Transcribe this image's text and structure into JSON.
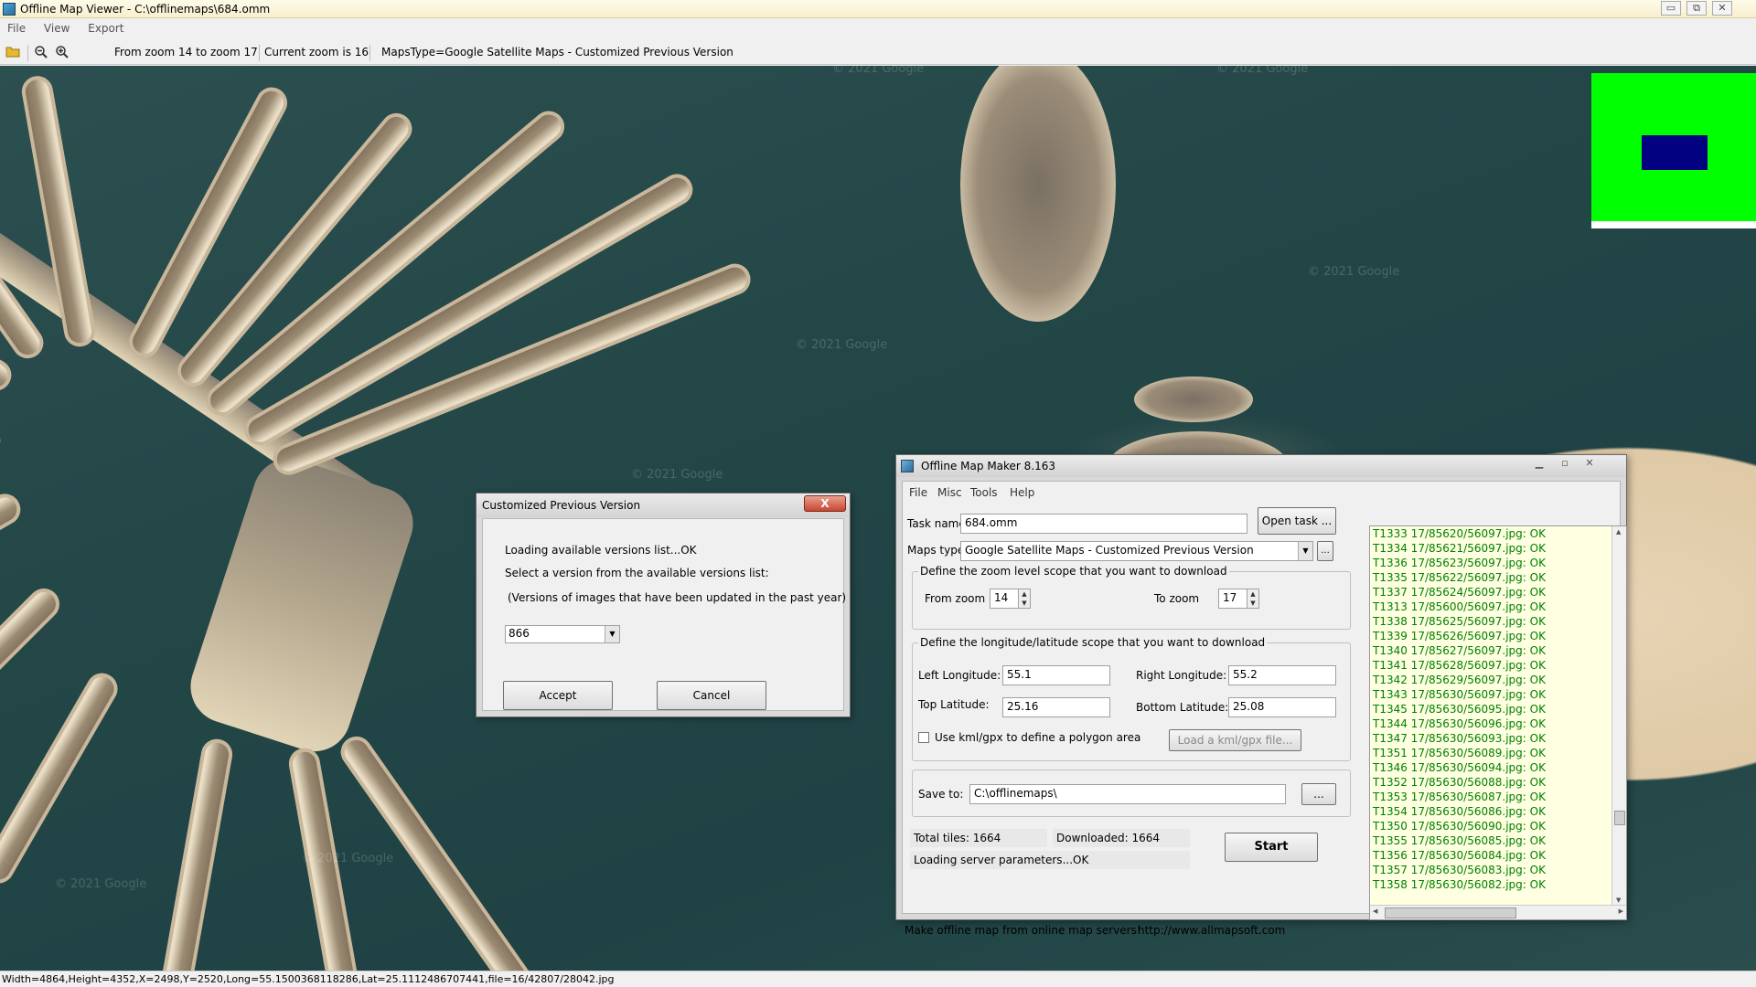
{
  "window": {
    "title": "Offline Map Viewer - C:\\offlinemaps\\684.omm",
    "controls": [
      "▭",
      "⧉",
      "✕"
    ]
  },
  "menubar": [
    "File",
    "View",
    "Export"
  ],
  "toolbar": {
    "zoom_range": "From zoom 14 to zoom 17",
    "current_zoom": "Current zoom is 16",
    "maps_type": "MapsType=Google Satellite Maps - Customized Previous Version"
  },
  "map": {
    "watermarks": [
      "© 2021 Google",
      "© 2021 Google",
      "© 2021 Google",
      "© 2021 Google",
      "© 2021 Google",
      "© 2021 Google",
      "© 2021 Google"
    ],
    "overview": {
      "colors": {
        "background": "#00ff00",
        "viewport": "#000080"
      }
    }
  },
  "statusbar": "Width=4864,Height=4352,X=2498,Y=2520,Long=55.1500368118286,Lat=25.1112486707441,file=16/42807/28042.jpg",
  "cpv_dialog": {
    "title": "Customized Previous Version",
    "close_label": "X",
    "line1": "Loading available versions list...OK",
    "line2": "Select a version  from the available versions list:",
    "line3": "(Versions of images that have been updated in the past year)",
    "version_value": "866",
    "accept_label": "Accept",
    "cancel_label": "Cancel"
  },
  "omm": {
    "title": "Offline Map Maker 8.163",
    "menu": [
      "File",
      "Misc",
      "Tools",
      "Help"
    ],
    "task_label": "Task name:",
    "task_value": "684.omm",
    "open_task_label": "Open task ...",
    "maps_type_label": "Maps type:",
    "maps_type_value": "Google Satellite Maps - Customized Previous Version",
    "browse_small": "...",
    "zoom_group": "Define the zoom level scope that you want to download",
    "from_zoom_label": "From zoom",
    "from_zoom_value": "14",
    "to_zoom_label": "To zoom",
    "to_zoom_value": "17",
    "lonlat_group": "Define the longitude/latitude scope that you want to download",
    "left_lon_label": "Left Longitude:",
    "left_lon_value": "55.1",
    "right_lon_label": "Right Longitude:",
    "right_lon_value": "55.2",
    "top_lat_label": "Top Latitude:",
    "top_lat_value": "25.16",
    "bottom_lat_label": "Bottom Latitude:",
    "bottom_lat_value": "25.08",
    "kml_label": "Use kml/gpx to define a polygon area",
    "load_kml_label": "Load a kml/gpx file...",
    "save_to_label": "Save to:",
    "save_to_value": "C:\\offlinemaps\\",
    "save_browse": "...",
    "total_tiles": "Total tiles: 1664",
    "downloaded": "Downloaded: 1664",
    "server_status": "Loading server parameters...OK",
    "start_label": "Start",
    "footer_text": "Make offline map from online map servers!",
    "footer_url": "http://www.allmapsoft.com",
    "log": [
      "T1333 17/85620/56097.jpg: OK",
      "T1334 17/85621/56097.jpg: OK",
      "T1336 17/85623/56097.jpg: OK",
      "T1335 17/85622/56097.jpg: OK",
      "T1337 17/85624/56097.jpg: OK",
      "T1313 17/85600/56097.jpg: OK",
      "T1338 17/85625/56097.jpg: OK",
      "T1339 17/85626/56097.jpg: OK",
      "T1340 17/85627/56097.jpg: OK",
      "T1341 17/85628/56097.jpg: OK",
      "T1342 17/85629/56097.jpg: OK",
      "T1343 17/85630/56097.jpg: OK",
      "T1345 17/85630/56095.jpg: OK",
      "T1344 17/85630/56096.jpg: OK",
      "T1347 17/85630/56093.jpg: OK",
      "T1351 17/85630/56089.jpg: OK",
      "T1346 17/85630/56094.jpg: OK",
      "T1352 17/85630/56088.jpg: OK",
      "T1353 17/85630/56087.jpg: OK",
      "T1354 17/85630/56086.jpg: OK",
      "T1350 17/85630/56090.jpg: OK",
      "T1355 17/85630/56085.jpg: OK",
      "T1356 17/85630/56084.jpg: OK",
      "T1357 17/85630/56083.jpg: OK",
      "T1358 17/85630/56082.jpg: OK"
    ]
  }
}
